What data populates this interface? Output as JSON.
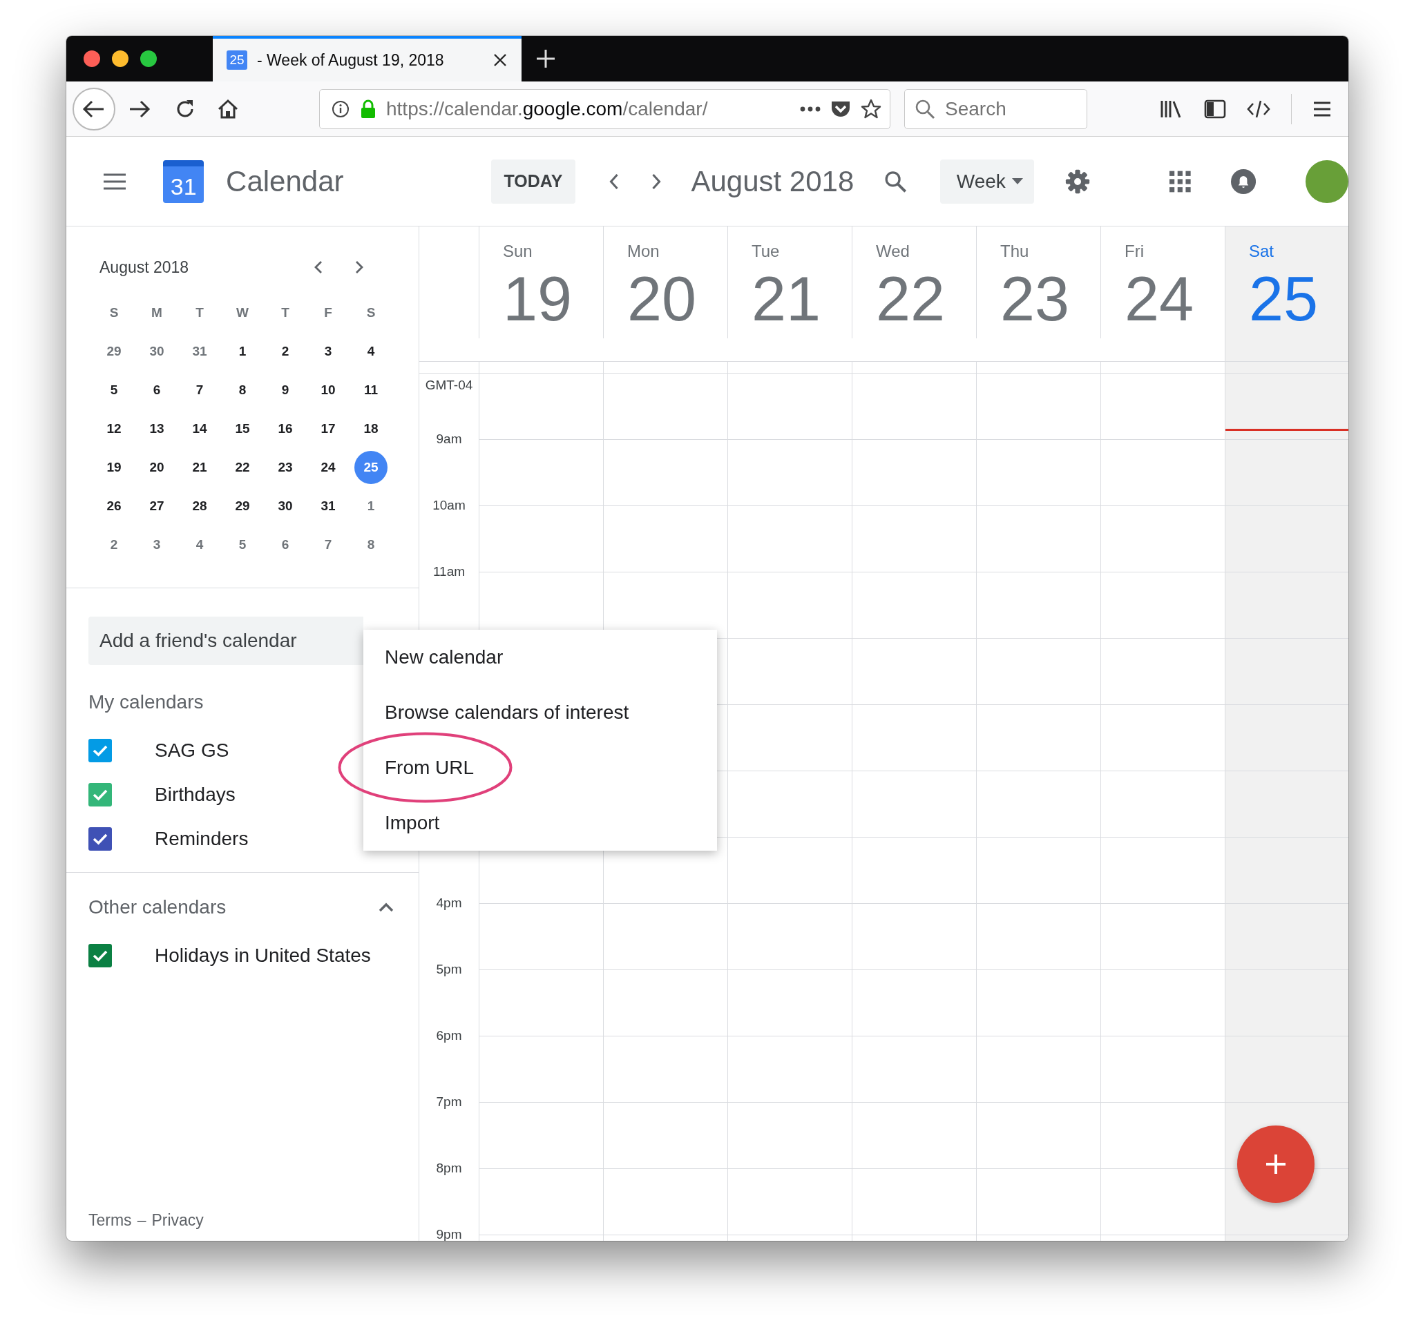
{
  "browser": {
    "tab": {
      "favicon": "25",
      "title": "- Week of August 19, 2018",
      "selected": true
    },
    "url": {
      "prefix": "https://calendar.",
      "domain": "google.com",
      "path": "/calendar/"
    },
    "search": {
      "placeholder": "Search"
    }
  },
  "header": {
    "logo_number": "31",
    "app_name": "Calendar",
    "today_button": "TODAY",
    "period": "August 2018",
    "view": "Week"
  },
  "mini_calendar": {
    "title": "August 2018",
    "weekdays": [
      "S",
      "M",
      "T",
      "W",
      "T",
      "F",
      "S"
    ],
    "weeks": [
      [
        {
          "d": "29",
          "other_month": true,
          "selected": false
        },
        {
          "d": "30",
          "other_month": true,
          "selected": false
        },
        {
          "d": "31",
          "other_month": true,
          "selected": false
        },
        {
          "d": "1",
          "other_month": false,
          "selected": false
        },
        {
          "d": "2",
          "other_month": false,
          "selected": false
        },
        {
          "d": "3",
          "other_month": false,
          "selected": false
        },
        {
          "d": "4",
          "other_month": false,
          "selected": false
        }
      ],
      [
        {
          "d": "5",
          "other_month": false,
          "selected": false
        },
        {
          "d": "6",
          "other_month": false,
          "selected": false
        },
        {
          "d": "7",
          "other_month": false,
          "selected": false
        },
        {
          "d": "8",
          "other_month": false,
          "selected": false
        },
        {
          "d": "9",
          "other_month": false,
          "selected": false
        },
        {
          "d": "10",
          "other_month": false,
          "selected": false
        },
        {
          "d": "11",
          "other_month": false,
          "selected": false
        }
      ],
      [
        {
          "d": "12",
          "other_month": false,
          "selected": false
        },
        {
          "d": "13",
          "other_month": false,
          "selected": false
        },
        {
          "d": "14",
          "other_month": false,
          "selected": false
        },
        {
          "d": "15",
          "other_month": false,
          "selected": false
        },
        {
          "d": "16",
          "other_month": false,
          "selected": false
        },
        {
          "d": "17",
          "other_month": false,
          "selected": false
        },
        {
          "d": "18",
          "other_month": false,
          "selected": false
        }
      ],
      [
        {
          "d": "19",
          "other_month": false,
          "selected": false
        },
        {
          "d": "20",
          "other_month": false,
          "selected": false
        },
        {
          "d": "21",
          "other_month": false,
          "selected": false
        },
        {
          "d": "22",
          "other_month": false,
          "selected": false
        },
        {
          "d": "23",
          "other_month": false,
          "selected": false
        },
        {
          "d": "24",
          "other_month": false,
          "selected": false
        },
        {
          "d": "25",
          "other_month": false,
          "selected": true
        }
      ],
      [
        {
          "d": "26",
          "other_month": false,
          "selected": false
        },
        {
          "d": "27",
          "other_month": false,
          "selected": false
        },
        {
          "d": "28",
          "other_month": false,
          "selected": false
        },
        {
          "d": "29",
          "other_month": false,
          "selected": false
        },
        {
          "d": "30",
          "other_month": false,
          "selected": false
        },
        {
          "d": "31",
          "other_month": false,
          "selected": false
        },
        {
          "d": "1",
          "other_month": true,
          "selected": false
        }
      ],
      [
        {
          "d": "2",
          "other_month": true,
          "selected": false
        },
        {
          "d": "3",
          "other_month": true,
          "selected": false
        },
        {
          "d": "4",
          "other_month": true,
          "selected": false
        },
        {
          "d": "5",
          "other_month": true,
          "selected": false
        },
        {
          "d": "6",
          "other_month": true,
          "selected": false
        },
        {
          "d": "7",
          "other_month": true,
          "selected": false
        },
        {
          "d": "8",
          "other_month": true,
          "selected": false
        }
      ]
    ]
  },
  "add_friend": {
    "placeholder": "Add a friend's calendar"
  },
  "my_calendars": {
    "title": "My calendars",
    "items": [
      {
        "name": "SAG GS",
        "checked": true,
        "color": "#039be5"
      },
      {
        "name": "Birthdays",
        "checked": true,
        "color": "#33b679"
      },
      {
        "name": "Reminders",
        "checked": true,
        "color": "#3f51b5"
      }
    ]
  },
  "other_calendars": {
    "title": "Other calendars",
    "expanded": true,
    "items": [
      {
        "name": "Holidays in United States",
        "checked": true,
        "color": "#0b8043"
      }
    ]
  },
  "footer": {
    "terms": "Terms",
    "separator": "–",
    "privacy": "Privacy"
  },
  "week": {
    "timezone": "GMT-04",
    "days": [
      {
        "name": "Sun",
        "date": "19",
        "selected": false
      },
      {
        "name": "Mon",
        "date": "20",
        "selected": false
      },
      {
        "name": "Tue",
        "date": "21",
        "selected": false
      },
      {
        "name": "Wed",
        "date": "22",
        "selected": false
      },
      {
        "name": "Thu",
        "date": "23",
        "selected": false
      },
      {
        "name": "Fri",
        "date": "24",
        "selected": false
      },
      {
        "name": "Sat",
        "date": "25",
        "selected": true
      }
    ],
    "hours_above_menu": [
      "9am",
      "10am",
      "11am"
    ],
    "hours_below_menu": [
      "4pm",
      "5pm",
      "6pm",
      "7pm",
      "8pm",
      "9pm"
    ]
  },
  "menu": {
    "items": [
      {
        "label": "New calendar",
        "circled": false
      },
      {
        "label": "Browse calendars of interest",
        "circled": false
      },
      {
        "label": "From URL",
        "circled": true
      },
      {
        "label": "Import",
        "circled": false
      }
    ]
  }
}
